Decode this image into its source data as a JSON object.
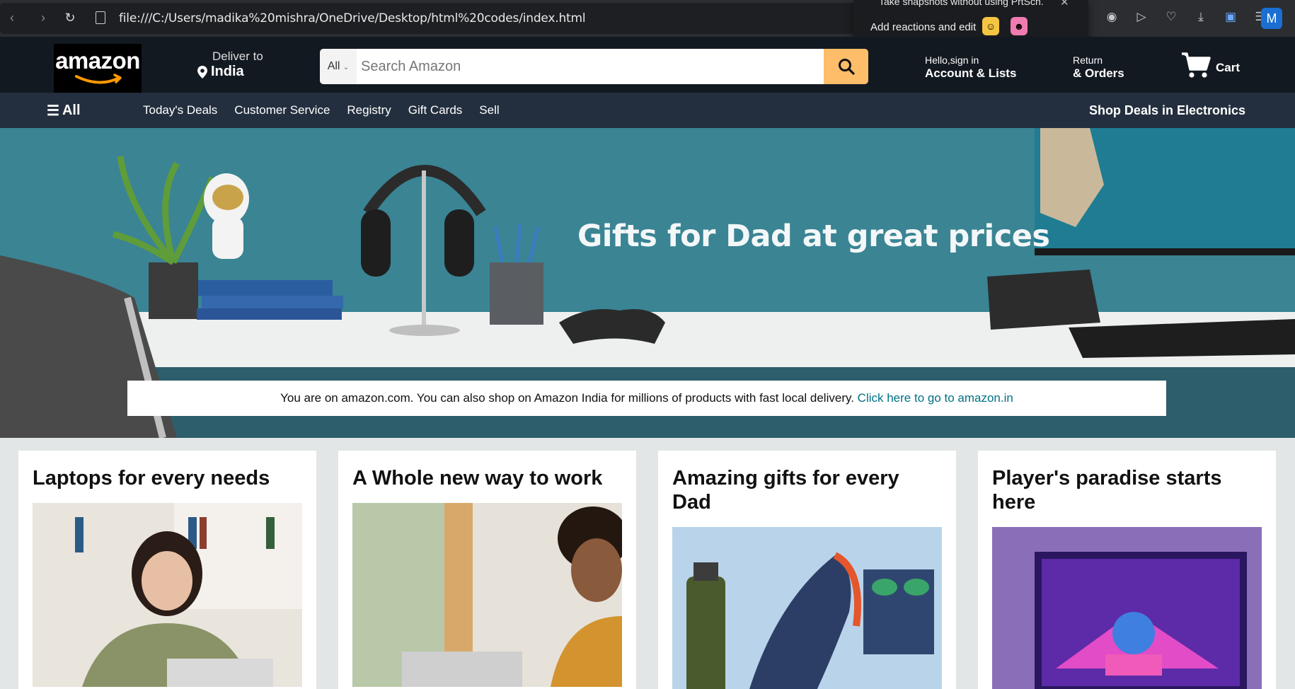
{
  "browser": {
    "url": "file:///C:/Users/madika%20mishra/OneDrive/Desktop/html%20codes/index.html",
    "profile_initial": "M",
    "popup": {
      "line1": "Take snapshots without using PrtSch.",
      "line2": "Add reactions and edit"
    }
  },
  "header": {
    "logo_text": "amazon",
    "deliver_label": "Deliver to",
    "deliver_value": "India",
    "search_category": "All",
    "search_placeholder": "Search Amazon",
    "account_small": "Hello,sign in",
    "account_bold": "Account & Lists",
    "orders_small": "Return",
    "orders_bold": "& Orders",
    "cart_label": "Cart"
  },
  "subnav": {
    "all_label": "All",
    "links": [
      "Today's Deals",
      "Customer Service",
      "Registry",
      "Gift Cards",
      "Sell"
    ],
    "right_label": "Shop Deals in Electronics"
  },
  "hero": {
    "title": "Gifts for Dad at great prices",
    "notice_text": "You are on amazon.com. You can also shop on Amazon India for millions of products with fast local delivery.",
    "notice_link": "Click here to go to amazon.in"
  },
  "cards": [
    {
      "title": "Laptops for every needs"
    },
    {
      "title": "A Whole new way to work"
    },
    {
      "title": "Amazing gifts for every Dad"
    },
    {
      "title": "Player's paradise starts here"
    }
  ],
  "colors": {
    "header_bg": "#131921",
    "subnav_bg": "#232f3e",
    "search_button": "#febd69",
    "link": "#007185",
    "page_bg": "#e3e6e6"
  }
}
